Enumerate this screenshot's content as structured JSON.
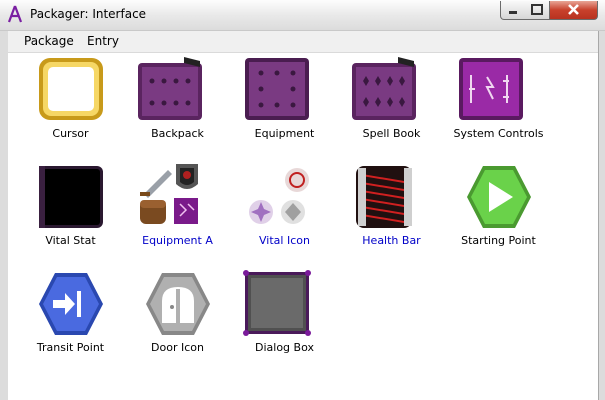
{
  "window": {
    "title": "Packager: Interface"
  },
  "menu": {
    "items": [
      "Package",
      "Entry"
    ]
  },
  "items": [
    {
      "label": "Cursor",
      "icon": "cursor-icon",
      "link": false
    },
    {
      "label": "Backpack",
      "icon": "backpack-icon",
      "link": false
    },
    {
      "label": "Equipment",
      "icon": "equipment-icon",
      "link": false
    },
    {
      "label": "Spell Book",
      "icon": "spell-book-icon",
      "link": false
    },
    {
      "label": "System Controls",
      "icon": "system-controls-icon",
      "link": false
    },
    {
      "label": "Vital Stat",
      "icon": "vital-stat-icon",
      "link": false
    },
    {
      "label": "Equipment A",
      "icon": "equipment-a-icon",
      "link": true
    },
    {
      "label": "Vital Icon",
      "icon": "vital-icon",
      "link": true
    },
    {
      "label": "Health Bar",
      "icon": "health-bar-icon",
      "link": true
    },
    {
      "label": "Starting Point",
      "icon": "starting-point-icon",
      "link": false
    },
    {
      "label": "Transit Point",
      "icon": "transit-point-icon",
      "link": false
    },
    {
      "label": "Door Icon",
      "icon": "door-icon",
      "link": false
    },
    {
      "label": "Dialog Box",
      "icon": "dialog-box-icon",
      "link": false
    }
  ],
  "colors": {
    "link": "#0000c8",
    "purple": "#6a2a72",
    "green": "#5cc84c",
    "blue": "#4060d0",
    "gray": "#a0a0a0",
    "red": "#c01818",
    "gold": "#c8a020"
  }
}
